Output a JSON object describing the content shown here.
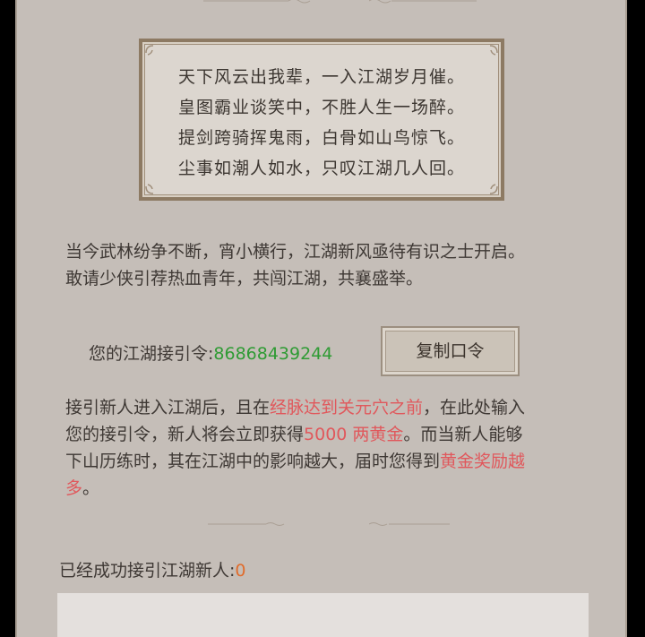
{
  "poem": {
    "lines": [
      "天下风云出我辈，一入江湖岁月催。",
      "皇图霸业谈笑中，不胜人生一场醉。",
      "提剑跨骑挥鬼雨，白骨如山鸟惊飞。",
      "尘事如潮人如水，只叹江湖几人回。"
    ]
  },
  "intro": {
    "line1": "当今武林纷争不断，宵小横行，江湖新风亟待有识之士开启。",
    "line2": "敢请少侠引荐热血青年，共闯江湖，共襄盛举。"
  },
  "invite": {
    "label": "您的江湖接引令:",
    "code": "86868439244",
    "copy_button": "复制口令"
  },
  "rules": {
    "l1_a": "接引新人进入江湖后，且在",
    "l1_red": "经脉达到关元穴之前",
    "l1_b": "，在此处输入",
    "l2_a": "您的接引令，新人将会立即获得",
    "l2_red": "5000 两黄金",
    "l2_b": "。而当新人能够",
    "l3_a": "下山历练时，其在江湖中的影响越大，届时您得到",
    "l3_red": "黄金奖励越",
    "l4_red": "多",
    "l4_b": "。"
  },
  "stats": {
    "label": "已经成功接引江湖新人:",
    "count": "0"
  },
  "colors": {
    "panel_bg": "#c5beb8",
    "highlight_red": "#e0585c",
    "code_green": "#2f9b34",
    "count_orange": "#e06c2c"
  }
}
